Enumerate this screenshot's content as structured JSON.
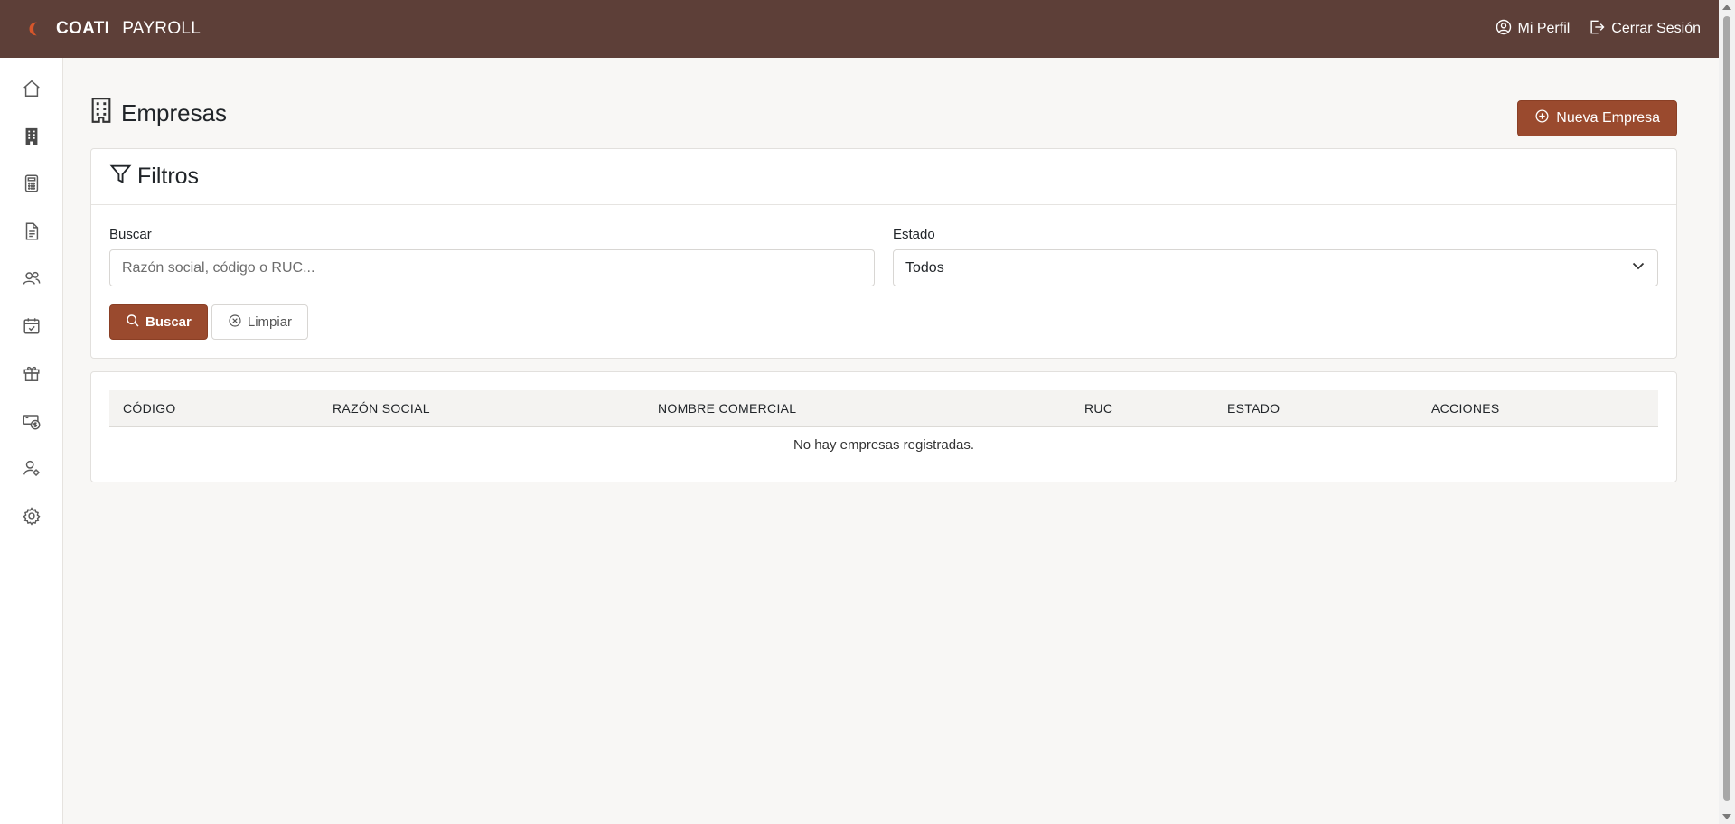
{
  "brand": {
    "name_strong": "COATI",
    "name_light": "PAYROLL"
  },
  "header": {
    "profile_label": "Mi Perfil",
    "logout_label": "Cerrar Sesión"
  },
  "sidebar": {
    "items": [
      {
        "icon": "home-icon"
      },
      {
        "icon": "building-icon"
      },
      {
        "icon": "calculator-icon"
      },
      {
        "icon": "document-icon"
      },
      {
        "icon": "users-icon"
      },
      {
        "icon": "calendar-check-icon"
      },
      {
        "icon": "gift-icon"
      },
      {
        "icon": "cash-icon"
      },
      {
        "icon": "user-gear-icon"
      },
      {
        "icon": "gear-icon"
      }
    ]
  },
  "page": {
    "title": "Empresas",
    "new_button": "Nueva Empresa"
  },
  "filters": {
    "title": "Filtros",
    "search_label": "Buscar",
    "search_placeholder": "Razón social, código o RUC...",
    "search_value": "",
    "status_label": "Estado",
    "status_value": "Todos",
    "search_button": "Buscar",
    "clear_button": "Limpiar"
  },
  "table": {
    "columns": [
      "Código",
      "Razón Social",
      "Nombre Comercial",
      "RUC",
      "Estado",
      "Acciones"
    ],
    "empty_message": "No hay empresas registradas."
  },
  "colors": {
    "topbar": "#5d3f38",
    "accent": "#9a4a2e",
    "background": "#f8f7f5"
  }
}
